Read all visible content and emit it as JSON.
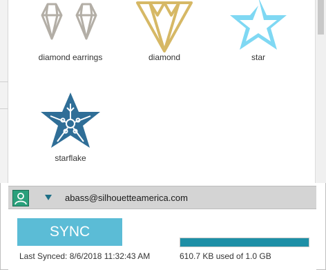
{
  "library": {
    "items": [
      {
        "label": "diamond earrings",
        "icon": "diamond-earrings-icon",
        "color": "#b3aea6"
      },
      {
        "label": "diamond",
        "icon": "diamond-icon",
        "color": "#d6b865"
      },
      {
        "label": "star",
        "icon": "star-icon",
        "color": "#7fd8f3"
      },
      {
        "label": "starflake",
        "icon": "starflake-icon",
        "color": "#2f6e97"
      }
    ]
  },
  "account": {
    "email": "abass@silhouetteamerica.com",
    "avatar_color": "#2aa07b"
  },
  "sync": {
    "button_label": "SYNC",
    "last_synced": "Last Synced: 8/6/2018 11:32:43 AM",
    "usage_text": "610.7 KB used of 1.0 GB",
    "usage_fraction": 1.0,
    "accent": "#5bbcd6"
  }
}
